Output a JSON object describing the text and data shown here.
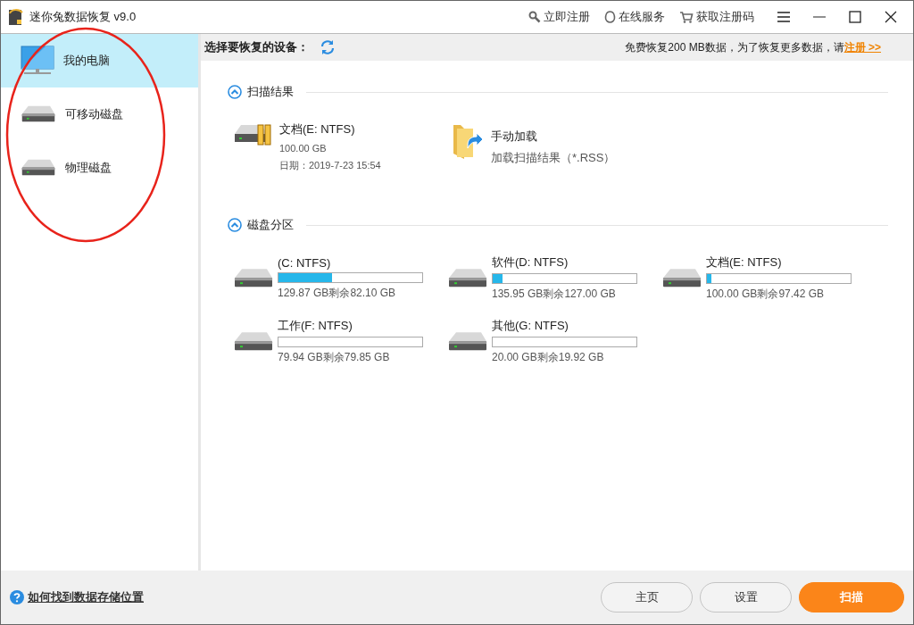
{
  "window": {
    "title": "迷你兔数据恢复 v9.0",
    "actions": [
      {
        "label": "立即注册",
        "kind": "key"
      },
      {
        "label": "在线服务",
        "kind": "support"
      },
      {
        "label": "获取注册码",
        "kind": "cart"
      }
    ]
  },
  "sidebar": {
    "items": [
      {
        "label": "我的电脑",
        "kind": "computer",
        "selected": true
      },
      {
        "label": "可移动磁盘",
        "kind": "drive",
        "selected": false
      },
      {
        "label": "物理磁盘",
        "kind": "drive",
        "selected": false
      }
    ]
  },
  "device_bar": {
    "label": "选择要恢复的设备：",
    "notice": "免费恢复200 MB数据，为了恢复更多数据，请",
    "notice_link": "注册 >>"
  },
  "scan_results": {
    "title": "扫描结果",
    "items": [
      {
        "kind": "drive",
        "name": "文档(E: NTFS)",
        "size": "100.00 GB",
        "date": "日期：2019-7-23 15:54"
      },
      {
        "kind": "load",
        "name": "手动加载",
        "description": "加载扫描结果（*.RSS）"
      }
    ]
  },
  "partitions": {
    "title": "磁盘分区",
    "items": [
      {
        "name": "(C: NTFS)",
        "level": 0.37,
        "usage": "129.87 GB剩余82.10 GB"
      },
      {
        "name": "软件(D: NTFS)",
        "level": 0.07,
        "usage": "135.95 GB剩余127.00 GB"
      },
      {
        "name": "文档(E: NTFS)",
        "level": 0.03,
        "usage": "100.00 GB剩余97.42 GB"
      },
      {
        "name": "工作(F: NTFS)",
        "level": 0,
        "usage": "79.94 GB剩余79.85 GB"
      },
      {
        "name": "其他(G: NTFS)",
        "level": 0,
        "usage": "20.00 GB剩余19.92 GB"
      }
    ]
  },
  "footer": {
    "help_link": "如何找到数据存储位置",
    "buttons": [
      {
        "label": "主页",
        "kind": "secondary"
      },
      {
        "label": "设置",
        "kind": "secondary"
      },
      {
        "label": "扫描",
        "kind": "primary"
      }
    ]
  }
}
